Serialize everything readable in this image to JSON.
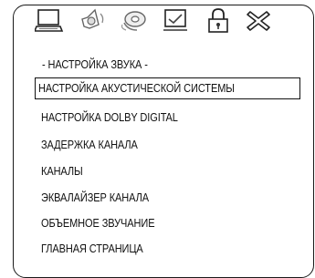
{
  "toolbar": {
    "icons": [
      {
        "name": "display-icon"
      },
      {
        "name": "speaker-icon"
      },
      {
        "name": "disc-icon"
      },
      {
        "name": "checkbox-icon"
      },
      {
        "name": "lock-icon"
      },
      {
        "name": "exit-icon"
      }
    ]
  },
  "menu": {
    "title": "- НАСТРОЙКА ЗВУКА -",
    "items": [
      {
        "label": "НАСТРОЙКА АКУСТИЧЕСКОЙ СИСТЕМЫ",
        "selected": true
      },
      {
        "label": "НАСТРОЙКА DOLBY DIGITAL"
      },
      {
        "label": "ЗАДЕРЖКА КАНАЛА"
      },
      {
        "label": "КАНАЛЫ"
      },
      {
        "label": "ЭКВАЛАЙЗЕР КАНАЛА"
      },
      {
        "label": "ОБЪЕМНОЕ ЗВУЧАНИЕ"
      },
      {
        "label": "ГЛАВНАЯ СТРАНИЦА"
      }
    ]
  }
}
